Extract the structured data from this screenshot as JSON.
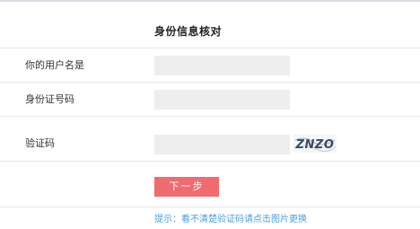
{
  "form": {
    "title": "身份信息核对",
    "fields": [
      {
        "label": "你的用户名是",
        "value": "",
        "placeholder": ""
      },
      {
        "label": "身份证号码",
        "value": "",
        "placeholder": ""
      },
      {
        "label": "验证码",
        "value": "",
        "placeholder": ""
      }
    ],
    "captcha_text": "ZNZO",
    "submit_label": "下一步",
    "hint": "提示：看不清楚验证码请点击图片更换"
  },
  "colors": {
    "accent": "#f06b6f",
    "hint": "#4a9fe0",
    "input_bg": "#eeeeee"
  }
}
